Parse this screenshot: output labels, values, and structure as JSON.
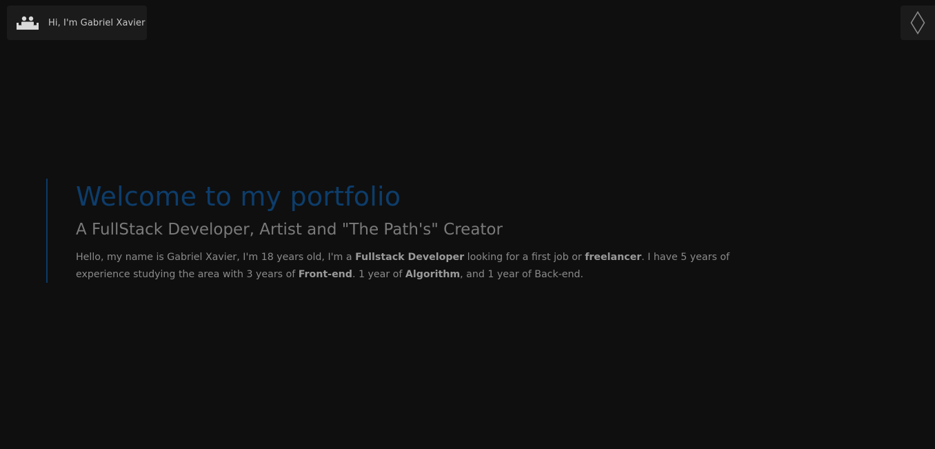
{
  "header": {
    "greeting": "Hi, I'm Gabriel Xavier",
    "logo_icon": "people-group-icon",
    "theme_icon": "diamond-icon"
  },
  "intro": {
    "title": "Welcome to my portfolio",
    "subtitle": "A FullStack Developer, Artist and \"The Path's\" Creator",
    "bio": {
      "p1": "Hello, my name is Gabriel Xavier, I'm 18 years old, I'm a ",
      "b1": "Fullstack Developer",
      "p2": " looking for a first job or ",
      "b2": "freelancer",
      "p3": ". I have 5 years of experience studying the area with 3 years of ",
      "b3": "Front-end",
      "p4": ". 1 year of ",
      "b4": "Algorithm",
      "p5": ", and 1 year of Back-end."
    }
  },
  "colors": {
    "background": "#0f0f0f",
    "chip": "#1b1b1b",
    "accent_blue": "#0d3d6b",
    "muted_text": "#7a7a7a"
  }
}
